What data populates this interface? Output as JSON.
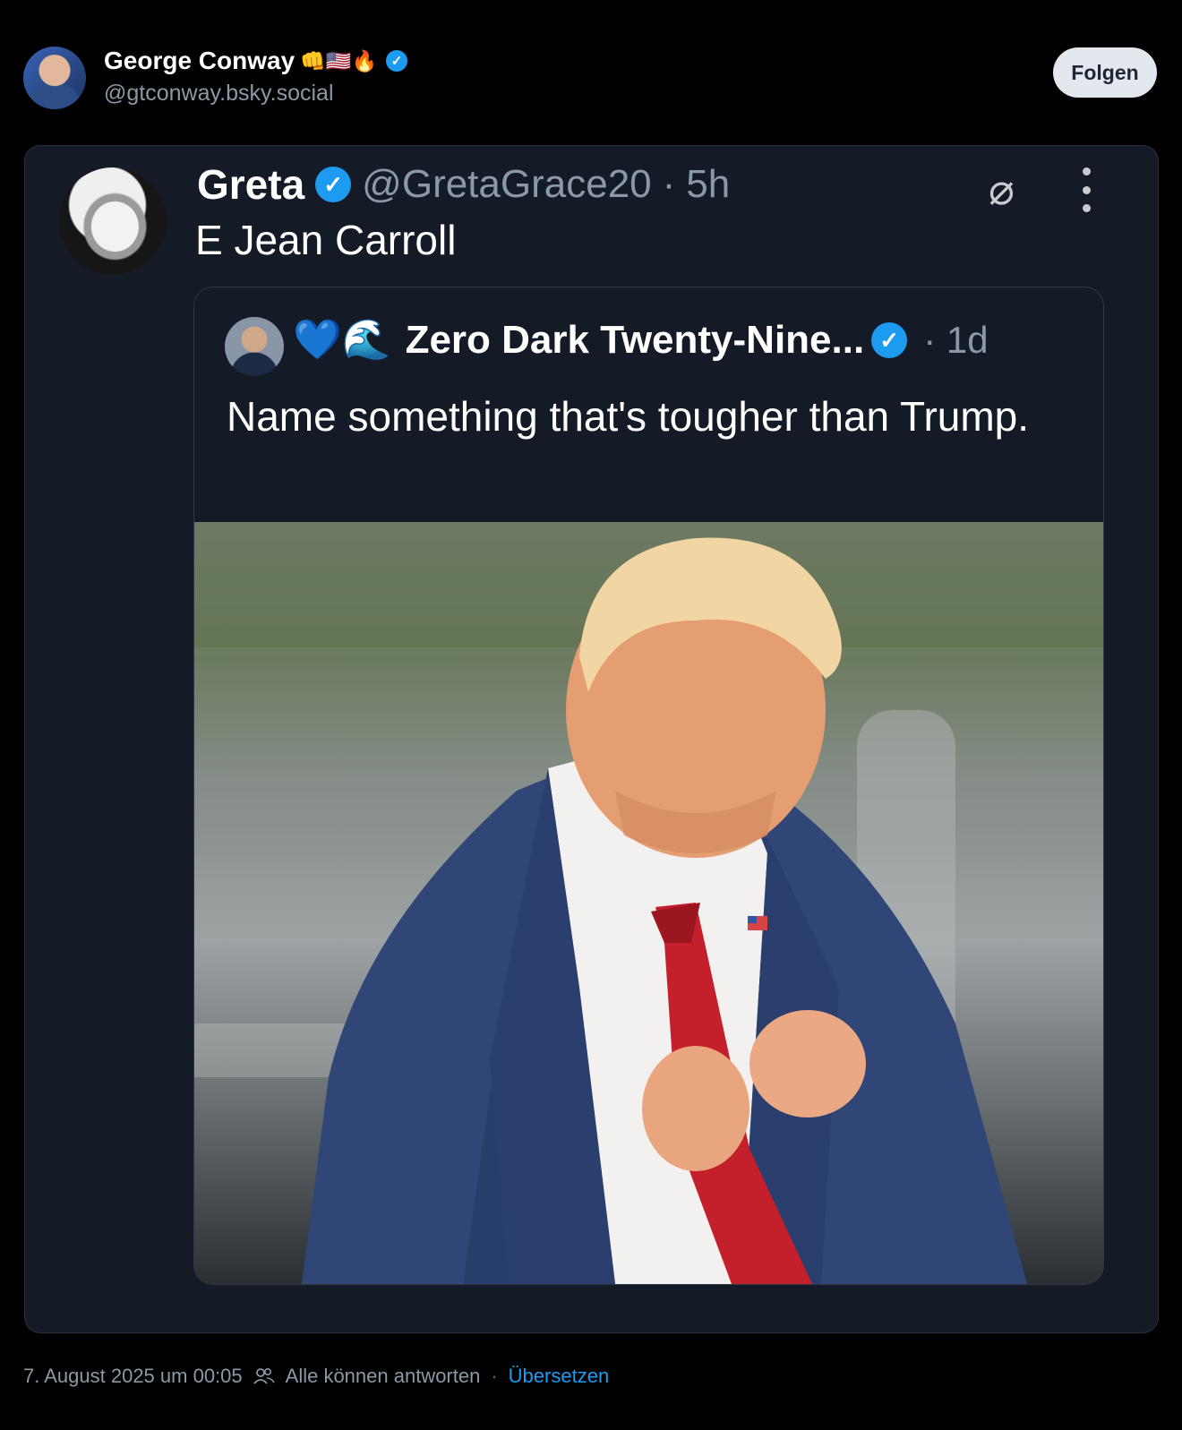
{
  "author": {
    "name": "George Conway",
    "emojis": "👊🇺🇸🔥",
    "verified_mark": "✓",
    "handle": "@gtconway.bsky.social",
    "follow_label": "Folgen"
  },
  "post": {
    "author_name": "Greta",
    "verified_mark": "✓",
    "handle": "@GretaGrace20",
    "separator": "·",
    "time": "5h",
    "text": "E Jean Carroll",
    "grok_icon_glyph": "⌀",
    "quote": {
      "emojis": "💙🌊",
      "name": "Zero Dark Twenty-Nine...",
      "verified_mark": "✓",
      "time": "· 1d",
      "text": "Name something that's tougher than Trump."
    }
  },
  "footer": {
    "date": "7. August 2025 um 00:05",
    "reply_setting": "Alle können antworten",
    "separator": "·",
    "translate_label": "Übersetzen"
  },
  "colors": {
    "background": "#000000",
    "card": "#141b26",
    "verified": "#1d9bf0",
    "link": "#1d9bf0",
    "muted": "#8b98a5"
  },
  "icons": [
    "verified-badge-icon",
    "grok-icon",
    "more-options-icon",
    "people-icon"
  ]
}
